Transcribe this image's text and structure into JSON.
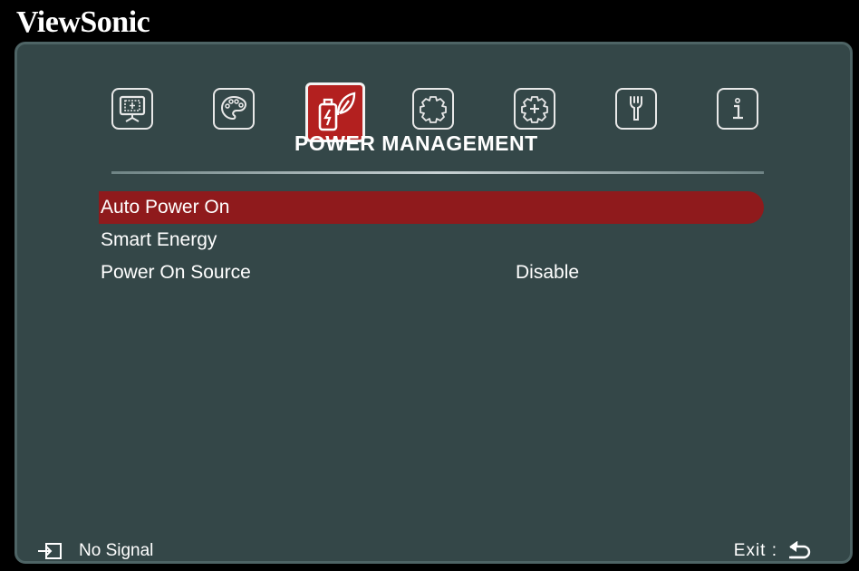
{
  "brand": "ViewSonic",
  "tabs": [
    {
      "id": "display",
      "icon": "projector-screen-icon"
    },
    {
      "id": "image",
      "icon": "palette-icon"
    },
    {
      "id": "power",
      "icon": "battery-leaf-icon",
      "active": true
    },
    {
      "id": "basic",
      "icon": "gear-icon"
    },
    {
      "id": "advanced",
      "icon": "gear-plus-icon"
    },
    {
      "id": "system",
      "icon": "wrench-icon"
    },
    {
      "id": "information",
      "icon": "info-icon"
    }
  ],
  "section_title": "POWER MANAGEMENT",
  "menu": [
    {
      "label": "Auto Power On",
      "value": "",
      "selected": true
    },
    {
      "label": "Smart Energy",
      "value": ""
    },
    {
      "label": "Power On Source",
      "value": "Disable"
    }
  ],
  "footer": {
    "source_status": "No Signal",
    "exit_label": "Exit :"
  },
  "colors": {
    "panel": "#344748",
    "active_tab": "#b3201f",
    "selected_row": "#8f1a1c"
  }
}
